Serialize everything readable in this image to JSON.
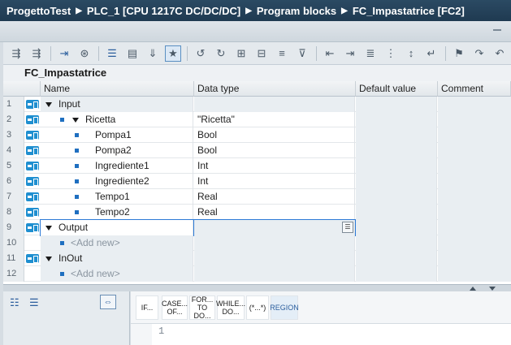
{
  "breadcrumb": [
    "ProgettoTest",
    "PLC_1 [CPU 1217C DC/DC/DC]",
    "Program blocks",
    "FC_Impastatrice [FC2]"
  ],
  "toolbar": {
    "icons": [
      "insert-network-icon",
      "delete-network-icon",
      "go-to-definition-icon",
      "monitor-icon",
      "interface-icon",
      "block-list-icon",
      "download-icon",
      "favorite-icon",
      "callers-icon",
      "callees-icon",
      "tag-icon",
      "compare-icon",
      "format-icon",
      "filter-icon",
      "indent-icon",
      "outdent-icon",
      "insert-line-icon",
      "align-icon",
      "sort-icon",
      "wrap-icon",
      "bookmark-icon",
      "next-bookmark-icon",
      "prev-bookmark-icon",
      "refresh-icon"
    ]
  },
  "block_title": "FC_Impastatrice",
  "columns": {
    "name": "Name",
    "data_type": "Data type",
    "default_value": "Default value",
    "comment": "Comment"
  },
  "rows": [
    {
      "num": "1",
      "kind": "section",
      "name": "Input",
      "type": "",
      "indent": 0
    },
    {
      "num": "2",
      "kind": "struct",
      "name": "Ricetta",
      "type": "\"Ricetta\"",
      "indent": 1
    },
    {
      "num": "3",
      "kind": "member",
      "name": "Pompa1",
      "type": "Bool",
      "indent": 2
    },
    {
      "num": "4",
      "kind": "member",
      "name": "Pompa2",
      "type": "Bool",
      "indent": 2
    },
    {
      "num": "5",
      "kind": "member",
      "name": "Ingrediente1",
      "type": "Int",
      "indent": 2
    },
    {
      "num": "6",
      "kind": "member",
      "name": "Ingrediente2",
      "type": "Int",
      "indent": 2
    },
    {
      "num": "7",
      "kind": "member",
      "name": "Tempo1",
      "type": "Real",
      "indent": 2
    },
    {
      "num": "8",
      "kind": "member",
      "name": "Tempo2",
      "type": "Real",
      "indent": 2
    },
    {
      "num": "9",
      "kind": "section",
      "name": "Output",
      "type": "",
      "indent": 0
    },
    {
      "num": "10",
      "kind": "addnew",
      "name": "<Add new>",
      "type": "",
      "indent": 1
    },
    {
      "num": "11",
      "kind": "section",
      "name": "InOut",
      "type": "",
      "indent": 0
    },
    {
      "num": "12",
      "kind": "addnew",
      "name": "<Add new>",
      "type": "",
      "indent": 1
    }
  ],
  "palette": [
    "IF...",
    "CASE... OF...",
    "FOR... TO DO...",
    "WHILE... DO...",
    "(*...*)",
    "REGION"
  ],
  "editor": {
    "line_number": "1"
  },
  "colors": {
    "breadcrumb_bg": "#1f3a51",
    "interface_icon": "#1f8fd0",
    "selection": "#2d7ad6"
  }
}
